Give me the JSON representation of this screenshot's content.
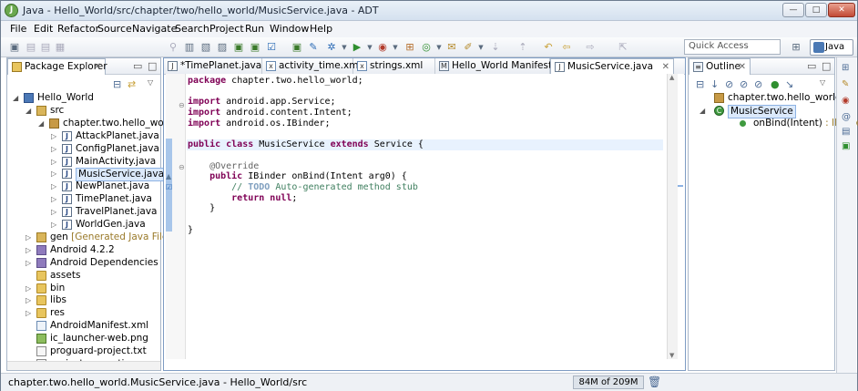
{
  "window": {
    "title": "Java - Hello_World/src/chapter/two/hello_world/MusicService.java - ADT",
    "buttons": {
      "minimize": "—",
      "maximize": "□",
      "close": "✕"
    }
  },
  "menubar": [
    "File",
    "Edit",
    "Refactor",
    "Source",
    "Navigate",
    "Search",
    "Project",
    "Run",
    "Window",
    "Help"
  ],
  "toolbar": {
    "quick_access_placeholder": "Quick Access",
    "perspective_label": "Java"
  },
  "package_explorer": {
    "tab_label": "Package Explorer",
    "tree": [
      {
        "label": "Hello_World",
        "icon": "project-icon",
        "depth": 0,
        "expanded": true
      },
      {
        "label": "src",
        "icon": "source-folder-icon",
        "depth": 1,
        "expanded": true
      },
      {
        "label": "chapter.two.hello_world",
        "icon": "package-icon",
        "depth": 2,
        "expanded": true
      },
      {
        "label": "AttackPlanet.java",
        "icon": "java-file-icon",
        "depth": 3
      },
      {
        "label": "ConfigPlanet.java",
        "icon": "java-file-icon",
        "depth": 3
      },
      {
        "label": "MainActivity.java",
        "icon": "java-file-icon",
        "depth": 3
      },
      {
        "label": "MusicService.java",
        "icon": "java-file-icon",
        "depth": 3,
        "selected": true
      },
      {
        "label": "NewPlanet.java",
        "icon": "java-file-icon",
        "depth": 3
      },
      {
        "label": "TimePlanet.java",
        "icon": "java-file-icon",
        "depth": 3
      },
      {
        "label": "TravelPlanet.java",
        "icon": "java-file-icon",
        "depth": 3
      },
      {
        "label": "WorldGen.java",
        "icon": "java-file-icon",
        "depth": 3
      },
      {
        "label": "gen",
        "suffix": "[Generated Java Files]",
        "icon": "source-folder-icon",
        "depth": 1
      },
      {
        "label": "Android 4.2.2",
        "icon": "library-icon",
        "depth": 1
      },
      {
        "label": "Android Dependencies",
        "icon": "library-icon",
        "depth": 1
      },
      {
        "label": "assets",
        "icon": "folder-icon",
        "depth": 1
      },
      {
        "label": "bin",
        "icon": "folder-icon",
        "depth": 1
      },
      {
        "label": "libs",
        "icon": "folder-icon",
        "depth": 1
      },
      {
        "label": "res",
        "icon": "folder-icon",
        "depth": 1
      },
      {
        "label": "AndroidManifest.xml",
        "icon": "xml-file-icon",
        "depth": 1
      },
      {
        "label": "ic_launcher-web.png",
        "icon": "image-file-icon",
        "depth": 1
      },
      {
        "label": "proguard-project.txt",
        "icon": "text-file-icon",
        "depth": 1
      },
      {
        "label": "project.properties",
        "icon": "text-file-icon",
        "depth": 1
      }
    ]
  },
  "editor": {
    "tabs": [
      {
        "label": "*TimePlanet.java",
        "icon": "java-file-icon"
      },
      {
        "label": "activity_time.xml",
        "icon": "xml-file-icon"
      },
      {
        "label": "strings.xml",
        "icon": "xml-file-icon"
      },
      {
        "label": "Hello_World Manifest",
        "icon": "manifest-icon"
      },
      {
        "label": "MusicService.java",
        "icon": "java-file-icon",
        "active": true
      }
    ],
    "lines": [
      {
        "parts": [
          [
            "kw",
            "package "
          ],
          [
            "",
            "chapter.two.hello_world;"
          ]
        ]
      },
      {
        "parts": []
      },
      {
        "parts": [
          [
            "kw",
            "import "
          ],
          [
            "",
            "android.app.Service;"
          ]
        ]
      },
      {
        "parts": [
          [
            "kw",
            "import "
          ],
          [
            "",
            "android.content.Intent;"
          ]
        ]
      },
      {
        "parts": [
          [
            "kw",
            "import "
          ],
          [
            "",
            "android.os.IBinder;"
          ]
        ]
      },
      {
        "parts": []
      },
      {
        "parts": [
          [
            "kw",
            "public class "
          ],
          [
            "",
            "MusicService "
          ],
          [
            "kw",
            "extends "
          ],
          [
            "",
            "Service {"
          ]
        ],
        "current": true
      },
      {
        "parts": []
      },
      {
        "parts": [
          [
            "ann",
            "    @Override"
          ]
        ]
      },
      {
        "parts": [
          [
            "kw",
            "    public "
          ],
          [
            "",
            "IBinder onBind(Intent arg0) {"
          ]
        ]
      },
      {
        "parts": [
          [
            "cmt",
            "        // "
          ],
          [
            "todo",
            "TODO"
          ],
          [
            "cmt",
            " Auto-generated method stub"
          ]
        ]
      },
      {
        "parts": [
          [
            "kw",
            "        return null"
          ],
          [
            "",
            ";"
          ]
        ]
      },
      {
        "parts": [
          [
            "",
            "    }"
          ]
        ]
      },
      {
        "parts": []
      },
      {
        "parts": [
          [
            "",
            "}"
          ]
        ]
      }
    ]
  },
  "outline": {
    "tab_label": "Outline",
    "items": [
      {
        "label": "chapter.two.hello_world",
        "icon": "package-icon",
        "depth": 0
      },
      {
        "label": "MusicService",
        "icon": "class-icon",
        "depth": 0,
        "selected": true,
        "expanded": true
      },
      {
        "label": "onBind(Intent)",
        "suffix": " : IBinder",
        "icon": "method-icon",
        "depth": 1
      }
    ]
  },
  "status": {
    "path": "chapter.two.hello_world.MusicService.java - Hello_World/src",
    "memory": "84M of 209M"
  }
}
